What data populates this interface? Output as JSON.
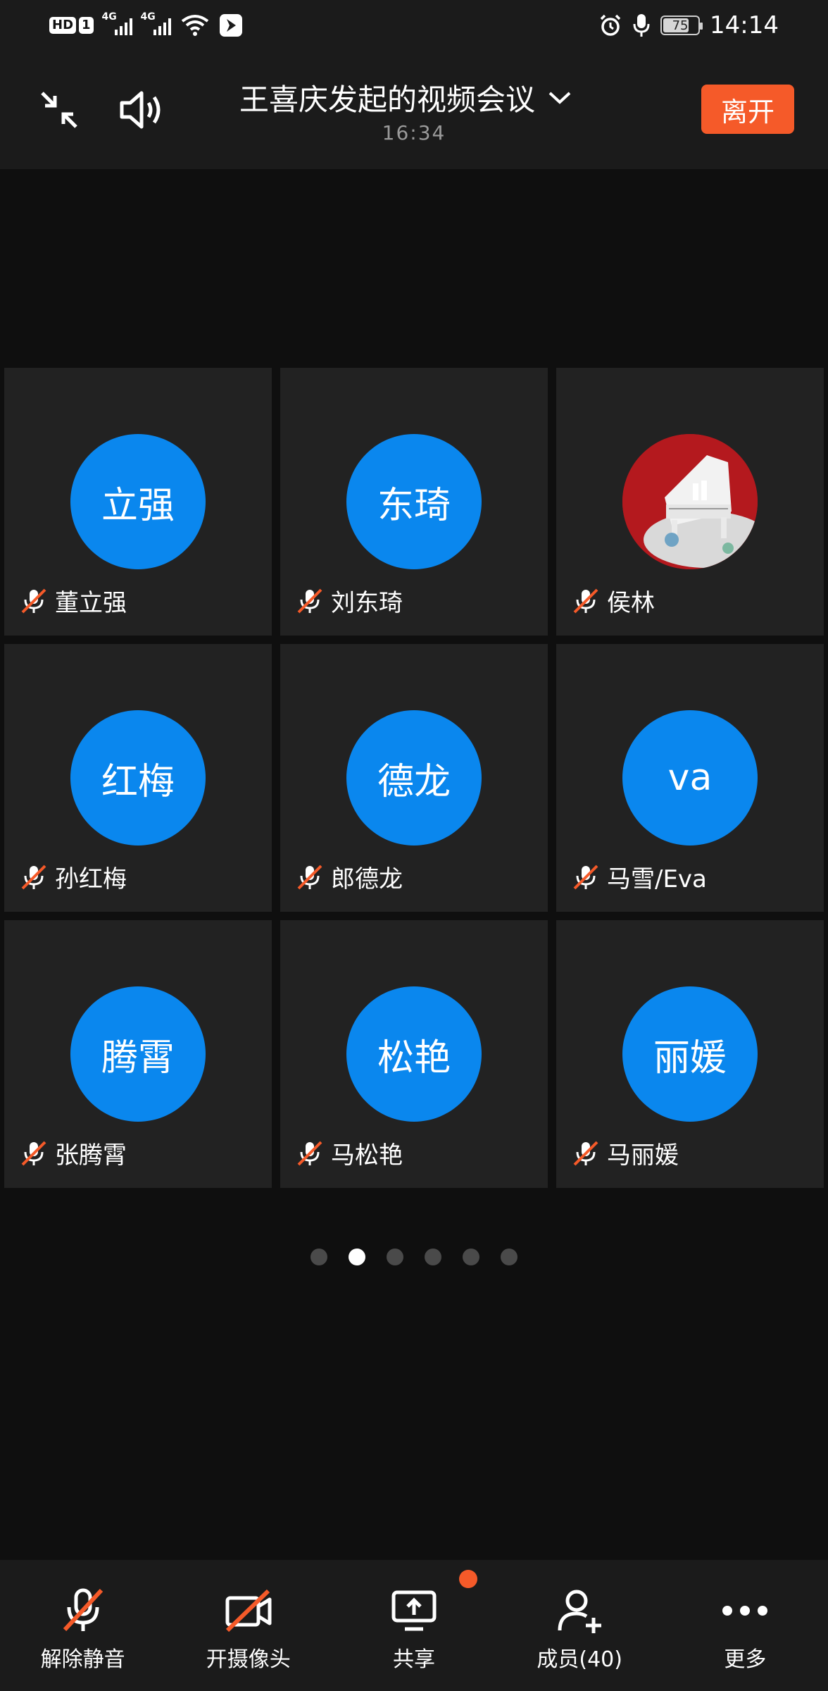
{
  "status_bar": {
    "hd_label": "HD",
    "sim_label": "1",
    "network_1": "4G",
    "network_2": "4G",
    "battery_level": "75",
    "time": "14:14"
  },
  "header": {
    "title": "王喜庆发起的视频会议",
    "timer": "16:34",
    "leave_label": "离开"
  },
  "participants": [
    {
      "name": "董立强",
      "avatar_text": "立强",
      "muted": true
    },
    {
      "name": "刘东琦",
      "avatar_text": "东琦",
      "muted": true
    },
    {
      "name": "侯林",
      "avatar_text": "",
      "avatar_type": "photo",
      "muted": true
    },
    {
      "name": "孙红梅",
      "avatar_text": "红梅",
      "muted": true
    },
    {
      "name": "郎德龙",
      "avatar_text": "德龙",
      "muted": true
    },
    {
      "name": "马雪/Eva",
      "avatar_text": "va",
      "muted": true
    },
    {
      "name": "张腾霄",
      "avatar_text": "腾霄",
      "muted": true
    },
    {
      "name": "马松艳",
      "avatar_text": "松艳",
      "muted": true
    },
    {
      "name": "马丽媛",
      "avatar_text": "丽媛",
      "muted": true
    }
  ],
  "pagination": {
    "pages": 6,
    "current": 2
  },
  "toolbar": {
    "unmute_label": "解除静音",
    "camera_label": "开摄像头",
    "share_label": "共享",
    "members_label": "成员(40)",
    "more_label": "更多"
  },
  "colors": {
    "accent_blue": "#0a87ee",
    "leave_orange": "#f55a29",
    "muted_red": "#f55a29",
    "background": "#0f0f0f",
    "tile": "#222222"
  }
}
